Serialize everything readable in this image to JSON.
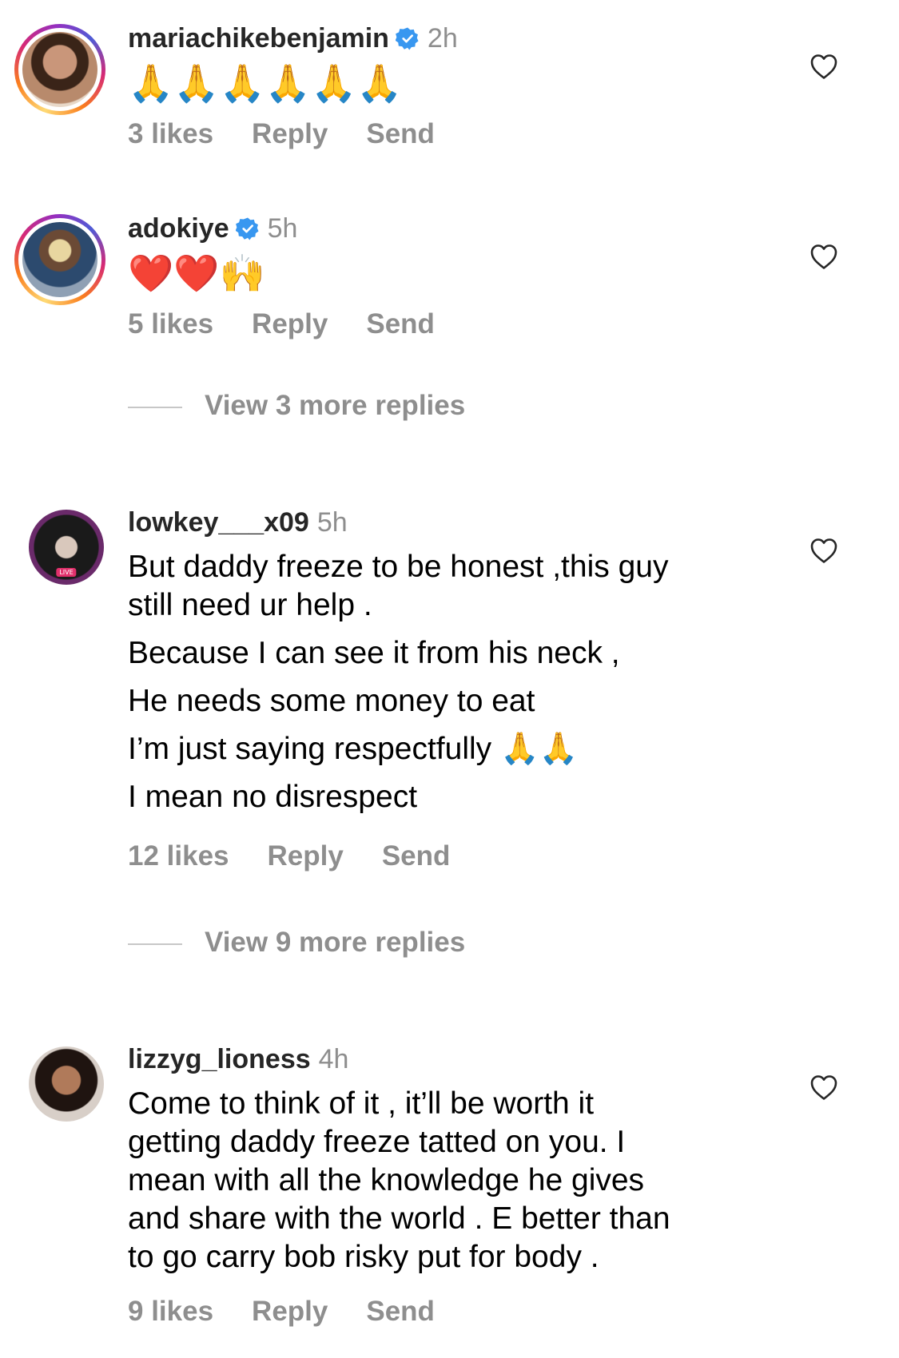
{
  "comments": [
    {
      "username": "mariachikebenjamin",
      "time": "2h",
      "verified": true,
      "emoji_text": "🙏🙏🙏🙏🙏🙏",
      "likes": "3 likes",
      "reply": "Reply",
      "send": "Send"
    },
    {
      "username": "adokiye",
      "time": "5h",
      "verified": true,
      "emoji_text": "❤️❤️🙌",
      "likes": "5 likes",
      "reply": "Reply",
      "send": "Send"
    },
    {
      "username": "lowkey___x09",
      "time": "5h",
      "verified": false,
      "live_badge": "LIVE",
      "lines": [
        "But daddy freeze to be honest ,this guy",
        "still need ur help .",
        "Because I can see it from his neck ,",
        "He needs some money to eat",
        "I’m just saying respectfully 🙏🙏",
        "I mean no disrespect"
      ],
      "likes": "12 likes",
      "reply": "Reply",
      "send": "Send"
    },
    {
      "username": "lizzyg_lioness",
      "time": "4h",
      "verified": false,
      "lines": [
        "Come to think of it , it’ll be worth it",
        "getting daddy freeze tatted on you. I",
        "mean with all the knowledge he gives",
        "and share with the world . E better than",
        "to go carry bob risky put for body ."
      ],
      "likes": "9 likes",
      "reply": "Reply",
      "send": "Send"
    }
  ],
  "view_more": [
    "View 3 more replies",
    "View 9 more replies"
  ],
  "icons": {
    "verified": "verified-badge-icon",
    "like": "heart-outline-icon"
  },
  "colors": {
    "verified_blue": "#3897f0",
    "secondary_text": "#8e8e8e"
  }
}
